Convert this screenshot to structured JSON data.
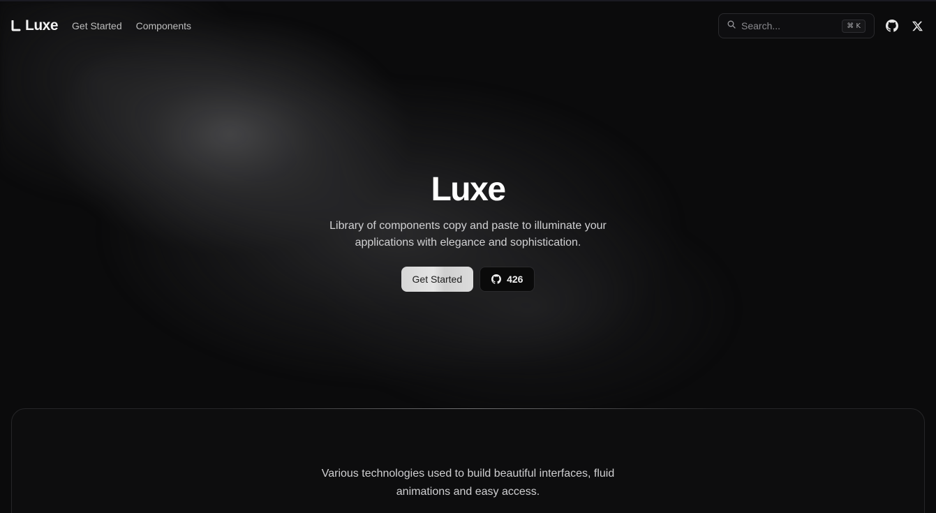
{
  "header": {
    "logo_text": "Luxe",
    "nav": [
      {
        "label": "Get Started"
      },
      {
        "label": "Components"
      }
    ],
    "search": {
      "placeholder": "Search...",
      "shortcut": "⌘ K"
    },
    "icons": [
      "github-icon",
      "x-icon"
    ]
  },
  "hero": {
    "title": "Luxe",
    "description": "Library of components copy and paste to illuminate your applications with elegance and sophistication.",
    "primary_button": "Get Started",
    "github_stars": "426"
  },
  "section": {
    "text": "Various technologies used to build beautiful interfaces, fluid animations and easy access."
  },
  "colors": {
    "background": "#0b0b0c",
    "primary_button_bg": "#d9d9d9",
    "text_primary": "#ffffff",
    "text_muted": "#bdbdbd"
  }
}
